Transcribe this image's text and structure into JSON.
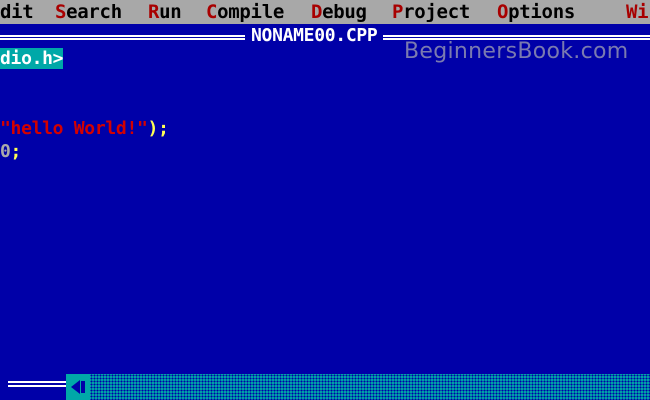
{
  "menu": [
    {
      "hotkey": "",
      "rest": "dit"
    },
    {
      "hotkey": "S",
      "rest": "earch"
    },
    {
      "hotkey": "R",
      "rest": "un"
    },
    {
      "hotkey": "C",
      "rest": "ompile"
    },
    {
      "hotkey": "D",
      "rest": "ebug"
    },
    {
      "hotkey": "P",
      "rest": "roject"
    },
    {
      "hotkey": "O",
      "rest": "ptions"
    },
    {
      "hotkey": "Wi",
      "rest": ""
    }
  ],
  "editor": {
    "title": "NONAME00.CPP",
    "watermark": "BeginnersBook.com",
    "lines": {
      "line1": "dio.h>",
      "line2_string": "\"hello World!\"",
      "line2_tail": ");",
      "line3_zero": "0",
      "line3_tail": ";"
    }
  },
  "colors": {
    "background": "#0000a8",
    "menubar": "#a8a8a8",
    "hotkey": "#a80000",
    "string": "#d40000",
    "highlight": "#00a8a8"
  },
  "icons": {
    "scroll_left": "left-arrow-icon"
  }
}
